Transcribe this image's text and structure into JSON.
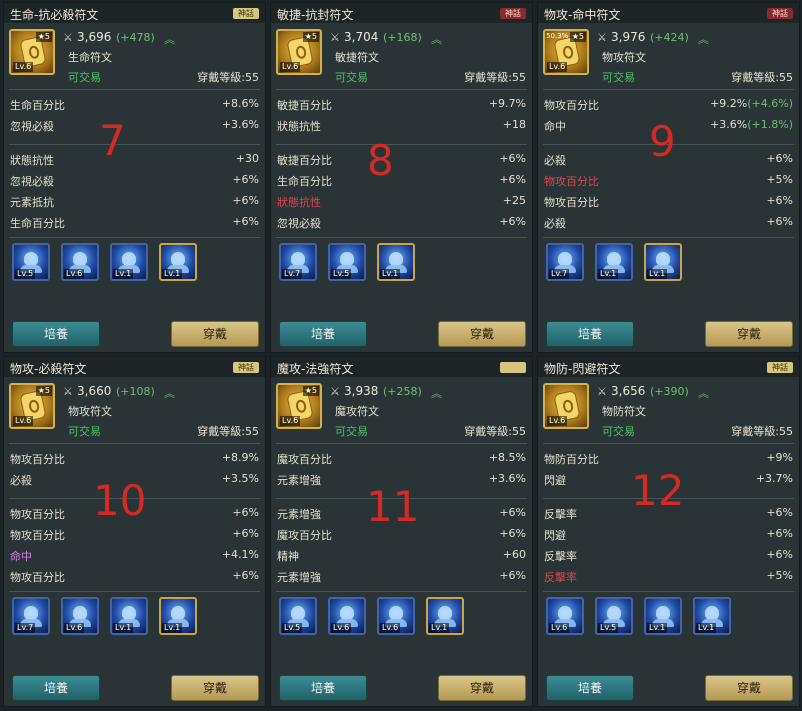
{
  "panels": [
    {
      "title": "生命-抗必殺符文",
      "grade": "神話",
      "grade_color": "gold",
      "stars": "★5",
      "rate": "",
      "level": "Lv.6",
      "power": "3,696",
      "power_delta": "(+478)",
      "rune_type": "生命符文",
      "tradeable": "可交易",
      "equip_level": "穿戴等級:55",
      "main_stats": [
        {
          "name": "生命百分比",
          "value": "+8.6%",
          "bonus": "",
          "color": ""
        },
        {
          "name": "忽視必殺",
          "value": "+3.6%",
          "bonus": "",
          "color": ""
        }
      ],
      "sub_stats": [
        {
          "name": "狀態抗性",
          "value": "+30",
          "color": ""
        },
        {
          "name": "忽視必殺",
          "value": "+6%",
          "color": ""
        },
        {
          "name": "元素抵抗",
          "value": "+6%",
          "color": ""
        },
        {
          "name": "生命百分比",
          "value": "+6%",
          "color": ""
        }
      ],
      "number": "7",
      "skills": [
        {
          "level": "Lv.5",
          "frame": "blue"
        },
        {
          "level": "Lv.6",
          "frame": "blue"
        },
        {
          "level": "Lv.1",
          "frame": "blue"
        },
        {
          "level": "Lv.1",
          "frame": "gold"
        }
      ],
      "cultivate_label": "培養",
      "equip_label": "穿戴"
    },
    {
      "title": "敏捷-抗封符文",
      "grade": "神話",
      "grade_color": "red",
      "stars": "★5",
      "rate": "",
      "level": "Lv.6",
      "power": "3,704",
      "power_delta": "(+168)",
      "rune_type": "敏捷符文",
      "tradeable": "可交易",
      "equip_level": "穿戴等級:55",
      "main_stats": [
        {
          "name": "敏捷百分比",
          "value": "+9.7%",
          "bonus": "",
          "color": ""
        },
        {
          "name": "狀態抗性",
          "value": "+18",
          "bonus": "",
          "color": ""
        }
      ],
      "sub_stats": [
        {
          "name": "敏捷百分比",
          "value": "+6%",
          "color": ""
        },
        {
          "name": "生命百分比",
          "value": "+6%",
          "color": ""
        },
        {
          "name": "狀態抗性",
          "value": "+25",
          "color": "red"
        },
        {
          "name": "忽視必殺",
          "value": "+6%",
          "color": ""
        }
      ],
      "number": "8",
      "skills": [
        {
          "level": "Lv.7",
          "frame": "blue"
        },
        {
          "level": "Lv.5",
          "frame": "blue"
        },
        {
          "level": "Lv.1",
          "frame": "gold"
        }
      ],
      "cultivate_label": "培養",
      "equip_label": "穿戴"
    },
    {
      "title": "物攻-命中符文",
      "grade": "神話",
      "grade_color": "red",
      "stars": "★5",
      "rate": "50.3%",
      "level": "Lv.6",
      "power": "3,976",
      "power_delta": "(+424)",
      "rune_type": "物攻符文",
      "tradeable": "可交易",
      "equip_level": "穿戴等級:55",
      "main_stats": [
        {
          "name": "物攻百分比",
          "value": "+9.2%",
          "bonus": "(+4.6%)",
          "color": ""
        },
        {
          "name": "命中",
          "value": "+3.6%",
          "bonus": "(+1.8%)",
          "color": ""
        }
      ],
      "sub_stats": [
        {
          "name": "必殺",
          "value": "+6%",
          "color": ""
        },
        {
          "name": "物攻百分比",
          "value": "+5%",
          "color": "red"
        },
        {
          "name": "物攻百分比",
          "value": "+6%",
          "color": ""
        },
        {
          "name": "必殺",
          "value": "+6%",
          "color": ""
        }
      ],
      "number": "9",
      "skills": [
        {
          "level": "Lv.7",
          "frame": "blue"
        },
        {
          "level": "Lv.1",
          "frame": "blue"
        },
        {
          "level": "Lv.1",
          "frame": "gold"
        }
      ],
      "cultivate_label": "培養",
      "equip_label": "穿戴"
    },
    {
      "title": "物攻-必殺符文",
      "grade": "神話",
      "grade_color": "gold",
      "stars": "★5",
      "rate": "",
      "level": "Lv.6",
      "power": "3,660",
      "power_delta": "(+108)",
      "rune_type": "物攻符文",
      "tradeable": "可交易",
      "equip_level": "穿戴等級:55",
      "main_stats": [
        {
          "name": "物攻百分比",
          "value": "+8.9%",
          "bonus": "",
          "color": ""
        },
        {
          "name": "必殺",
          "value": "+3.5%",
          "bonus": "",
          "color": ""
        }
      ],
      "sub_stats": [
        {
          "name": "物攻百分比",
          "value": "+6%",
          "color": ""
        },
        {
          "name": "物攻百分比",
          "value": "+6%",
          "color": ""
        },
        {
          "name": "命中",
          "value": "+4.1%",
          "color": "purple"
        },
        {
          "name": "物攻百分比",
          "value": "+6%",
          "color": ""
        }
      ],
      "number": "10",
      "skills": [
        {
          "level": "Lv.7",
          "frame": "blue"
        },
        {
          "level": "Lv.6",
          "frame": "blue"
        },
        {
          "level": "Lv.1",
          "frame": "blue"
        },
        {
          "level": "Lv.1",
          "frame": "gold"
        }
      ],
      "cultivate_label": "培養",
      "equip_label": "穿戴"
    },
    {
      "title": "魔攻-法強符文",
      "grade": "",
      "grade_color": "gold",
      "stars": "★5",
      "rate": "",
      "level": "Lv.6",
      "power": "3,938",
      "power_delta": "(+258)",
      "rune_type": "魔攻符文",
      "tradeable": "可交易",
      "equip_level": "穿戴等級:55",
      "main_stats": [
        {
          "name": "魔攻百分比",
          "value": "+8.5%",
          "bonus": "",
          "color": ""
        },
        {
          "name": "元素增強",
          "value": "+3.6%",
          "bonus": "",
          "color": ""
        }
      ],
      "sub_stats": [
        {
          "name": "元素增強",
          "value": "+6%",
          "color": ""
        },
        {
          "name": "魔攻百分比",
          "value": "+6%",
          "color": ""
        },
        {
          "name": "精神",
          "value": "+60",
          "color": ""
        },
        {
          "name": "元素增強",
          "value": "+6%",
          "color": ""
        }
      ],
      "number": "11",
      "skills": [
        {
          "level": "Lv.5",
          "frame": "blue"
        },
        {
          "level": "Lv.6",
          "frame": "blue"
        },
        {
          "level": "Lv.6",
          "frame": "blue"
        },
        {
          "level": "Lv.1",
          "frame": "gold"
        }
      ],
      "cultivate_label": "培養",
      "equip_label": "穿戴"
    },
    {
      "title": "物防-閃避符文",
      "grade": "神話",
      "grade_color": "gold",
      "stars": "",
      "rate": "",
      "level": "Lv.6",
      "power": "3,656",
      "power_delta": "(+390)",
      "rune_type": "物防符文",
      "tradeable": "可交易",
      "equip_level": "穿戴等級:55",
      "main_stats": [
        {
          "name": "物防百分比",
          "value": "+9%",
          "bonus": "",
          "color": ""
        },
        {
          "name": "閃避",
          "value": "+3.7%",
          "bonus": "",
          "color": ""
        }
      ],
      "sub_stats": [
        {
          "name": "反擊率",
          "value": "+6%",
          "color": ""
        },
        {
          "name": "閃避",
          "value": "+6%",
          "color": ""
        },
        {
          "name": "反擊率",
          "value": "+6%",
          "color": ""
        },
        {
          "name": "反擊率",
          "value": "+5%",
          "color": "red"
        }
      ],
      "number": "12",
      "skills": [
        {
          "level": "Lv.6",
          "frame": "blue"
        },
        {
          "level": "Lv.5",
          "frame": "blue"
        },
        {
          "level": "Lv.1",
          "frame": "blue"
        },
        {
          "level": "Lv.1",
          "frame": "blue"
        }
      ],
      "cultivate_label": "培養",
      "equip_label": "穿戴"
    }
  ]
}
